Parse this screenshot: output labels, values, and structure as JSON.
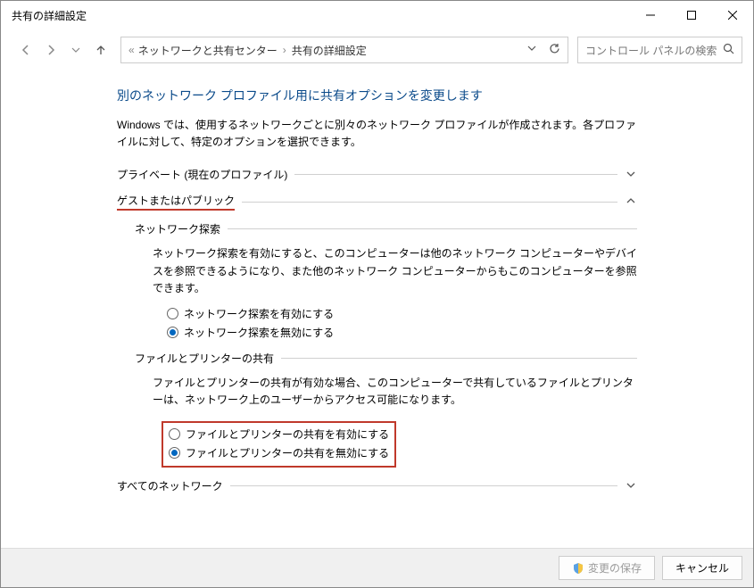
{
  "window": {
    "title": "共有の詳細設定"
  },
  "breadcrumb": {
    "first_chevrons": "«",
    "item1": "ネットワークと共有センター",
    "sep": "›",
    "item2": "共有の詳細設定"
  },
  "search": {
    "placeholder": "コントロール パネルの検索"
  },
  "page": {
    "title": "別のネットワーク プロファイル用に共有オプションを変更します",
    "desc": "Windows では、使用するネットワークごとに別々のネットワーク プロファイルが作成されます。各プロファイルに対して、特定のオプションを選択できます。"
  },
  "sections": {
    "private": {
      "title": "プライベート (現在のプロファイル)"
    },
    "guest": {
      "title": "ゲストまたはパブリック",
      "discovery": {
        "title": "ネットワーク探索",
        "desc": "ネットワーク探索を有効にすると、このコンピューターは他のネットワーク コンピューターやデバイスを参照できるようになり、また他のネットワーク コンピューターからもこのコンピューターを参照できます。",
        "opt_on": "ネットワーク探索を有効にする",
        "opt_off": "ネットワーク探索を無効にする"
      },
      "fileprint": {
        "title": "ファイルとプリンターの共有",
        "desc": "ファイルとプリンターの共有が有効な場合、このコンピューターで共有しているファイルとプリンターは、ネットワーク上のユーザーからアクセス可能になります。",
        "opt_on": "ファイルとプリンターの共有を有効にする",
        "opt_off": "ファイルとプリンターの共有を無効にする"
      }
    },
    "all": {
      "title": "すべてのネットワーク"
    }
  },
  "buttons": {
    "save": "変更の保存",
    "cancel": "キャンセル"
  }
}
